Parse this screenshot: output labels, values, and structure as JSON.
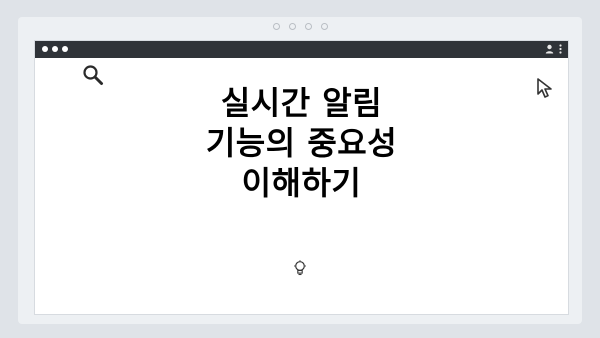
{
  "icons": {
    "window_dots": "window-control-dots",
    "user": "user-icon",
    "menu": "kebab-menu-icon",
    "search": "search-icon",
    "cursor": "mouse-pointer-icon",
    "idea": "lightbulb-icon"
  },
  "colors": {
    "background": "#dfe3e8",
    "titlebar": "#2f3338",
    "content": "#ffffff",
    "text": "#000000"
  },
  "main": {
    "title_lines": [
      "실시간 알림",
      "기능의 중요성",
      "이해하기"
    ]
  }
}
